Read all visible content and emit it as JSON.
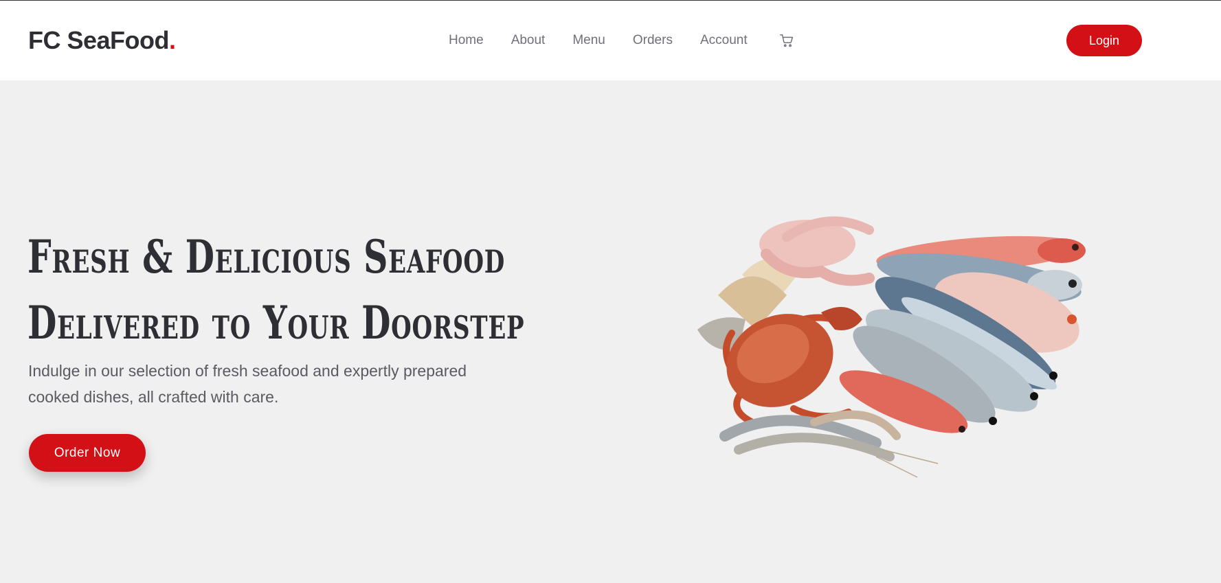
{
  "brand": {
    "name": "FC SeaFood",
    "dot": ".",
    "accent_color": "#d21015"
  },
  "nav": {
    "items": [
      {
        "label": "Home"
      },
      {
        "label": "About"
      },
      {
        "label": "Menu"
      },
      {
        "label": "Orders"
      },
      {
        "label": "Account"
      }
    ],
    "cart_icon": "cart-icon"
  },
  "login": {
    "label": "Login"
  },
  "hero": {
    "title_line1": "Fresh & Delicious Seafood",
    "title_line2": "Delivered to Your Doorstep",
    "subtitle": "Indulge in our selection of fresh seafood and expertly prepared cooked dishes, all crafted with care.",
    "cta_label": "Order Now",
    "image": "seafood-assortment-image"
  }
}
